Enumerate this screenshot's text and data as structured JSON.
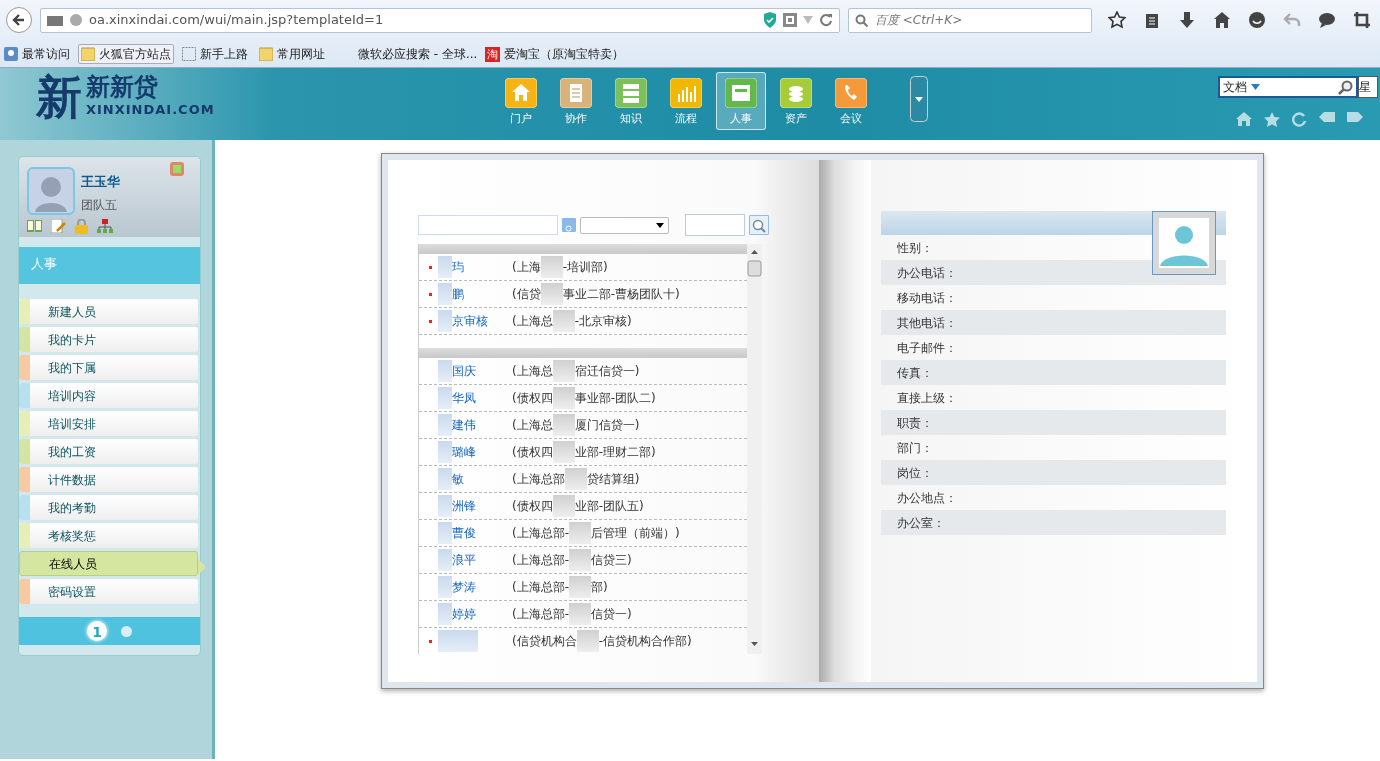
{
  "browser": {
    "url": "oa.xinxindai.com/wui/main.jsp?templateId=1",
    "search_placeholder": "百度 <Ctrl+K>",
    "bookmarks": [
      {
        "label": "最常访问",
        "kind": "special"
      },
      {
        "label": "火狐官方站点",
        "kind": "folder"
      },
      {
        "label": "新手上路",
        "kind": "page"
      },
      {
        "label": "常用网址",
        "kind": "folder"
      },
      {
        "label": "微软必应搜索 - 全球...",
        "kind": "plain"
      },
      {
        "label": "爱淘宝（原淘宝特卖）",
        "kind": "taobao",
        "icon_text": "淘"
      }
    ]
  },
  "header": {
    "logo_mark": "新",
    "logo_text": "新新贷",
    "logo_sub": "XINXINDAI.COM",
    "nav": [
      {
        "label": "门户",
        "kind": "home",
        "selected": false
      },
      {
        "label": "协作",
        "kind": "doc",
        "selected": false
      },
      {
        "label": "知识",
        "kind": "stack",
        "selected": false
      },
      {
        "label": "流程",
        "kind": "chart",
        "selected": false
      },
      {
        "label": "人事",
        "kind": "card",
        "selected": true
      },
      {
        "label": "资产",
        "kind": "coins",
        "selected": false
      },
      {
        "label": "会议",
        "kind": "phone",
        "selected": false
      }
    ],
    "search": {
      "value": "文档"
    },
    "cut_button": "星"
  },
  "sidebar": {
    "user": {
      "name": "王玉华",
      "team": "团队五"
    },
    "section": "人事",
    "menu": [
      {
        "label": "新建人员",
        "color": "#e8eeb8",
        "selected": false
      },
      {
        "label": "我的卡片",
        "color": "#d3e4a4",
        "selected": false
      },
      {
        "label": "我的下属",
        "color": "#f7caa4",
        "selected": false
      },
      {
        "label": "培训内容",
        "color": "#b8e0ef",
        "selected": false
      },
      {
        "label": "培训安排",
        "color": "#e8eeb8",
        "selected": false
      },
      {
        "label": "我的工资",
        "color": "#d3e4a4",
        "selected": false
      },
      {
        "label": "计件数据",
        "color": "#f7caa4",
        "selected": false
      },
      {
        "label": "我的考勤",
        "color": "#b8e0ef",
        "selected": false
      },
      {
        "label": "考核奖惩",
        "color": "#e8eeb8",
        "selected": false
      },
      {
        "label": "在线人员",
        "color": "#d3e4a4",
        "selected": true
      },
      {
        "label": "密码设置",
        "color": "#f7caa4",
        "selected": false
      }
    ],
    "pages": [
      {
        "label": "1",
        "selected": true
      },
      {
        "selected": false
      }
    ]
  },
  "book": {
    "groups": [
      {
        "rows": [
          {
            "marked": true,
            "name": "玙",
            "dept_start": "(上海",
            "dept_end": "-培训部)"
          },
          {
            "marked": true,
            "name": "鹏",
            "dept_start": "(信贷",
            "dept_end": "事业二部-曹杨团队十)"
          },
          {
            "marked": true,
            "name": "京审核",
            "dept_start": "(上海总",
            "dept_end": "-北京审核)"
          }
        ]
      },
      {
        "rows": [
          {
            "marked": false,
            "name": "国庆",
            "dept_start": "(上海总",
            "dept_end": "宿迁信贷一)"
          },
          {
            "marked": false,
            "name": "华凤",
            "dept_start": "(债权四",
            "dept_end": "事业部-团队二)"
          },
          {
            "marked": false,
            "name": "建伟",
            "dept_start": "(上海总",
            "dept_end": "厦门信贷一)"
          },
          {
            "marked": false,
            "name": "璐峰",
            "dept_start": "(债权四",
            "dept_end": "业部-理财二部)"
          },
          {
            "marked": false,
            "name": "敏",
            "dept_start": "(上海总部",
            "dept_end": "贷结算组)"
          },
          {
            "marked": false,
            "name": "洲锋",
            "dept_start": "(债权四",
            "dept_end": "业部-团队五)"
          },
          {
            "marked": false,
            "name": "曹俊",
            "dept_start": "(上海总部-",
            "dept_end": "后管理（前端）)"
          },
          {
            "marked": false,
            "name": "浪平",
            "dept_start": "(上海总部-",
            "dept_end": "信贷三)"
          },
          {
            "marked": false,
            "name": "梦涛",
            "dept_start": "(上海总部-",
            "dept_end": "部)"
          },
          {
            "marked": false,
            "name": "婷婷",
            "dept_start": "(上海总部-",
            "dept_end": "信贷一)"
          },
          {
            "marked": true,
            "name": "",
            "dept_start": "(信贷机构合",
            "dept_end": "-信贷机构合作部)"
          }
        ]
      }
    ],
    "fields": [
      "性别：",
      "办公电话：",
      "移动电话：",
      "其他电话：",
      "电子邮件：",
      "传真：",
      "直接上级：",
      "职责：",
      "部门：",
      "岗位：",
      "办公地点：",
      "办公室："
    ]
  }
}
